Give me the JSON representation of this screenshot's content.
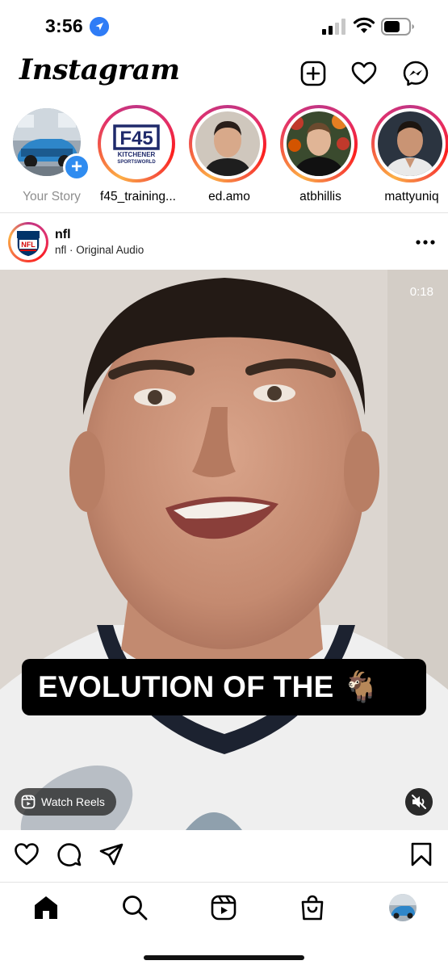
{
  "status_bar": {
    "time": "3:56",
    "icons": [
      "location-arrow-icon",
      "cellular-signal-icon",
      "wifi-icon",
      "battery-icon"
    ]
  },
  "header": {
    "logo_text": "Instagram",
    "icons": [
      "new-post-icon",
      "heart-icon",
      "messenger-icon"
    ]
  },
  "stories": [
    {
      "username": "Your Story",
      "own": true
    },
    {
      "username": "f45_training...",
      "own": false
    },
    {
      "username": "ed.amo",
      "own": false
    },
    {
      "username": "atbhillis",
      "own": false
    },
    {
      "username": "mattyuniq",
      "own": false
    }
  ],
  "stories_logo": {
    "brand": "F45",
    "caption_line1": "KITCHENER",
    "caption_line2": "SPORTSWORLD"
  },
  "post": {
    "username": "nfl",
    "subtitle": "nfl · Original Audio",
    "avatar_logo_text": "NFL",
    "duration": "0:18",
    "overlay_text": "EVOLUTION OF THE 🐐",
    "watch_reels_label": "Watch Reels"
  },
  "tab_bar": {
    "items": [
      "home-icon",
      "search-icon",
      "reels-icon",
      "shop-icon",
      "profile-avatar"
    ]
  },
  "colors": {
    "story_ring_start": "#c13584",
    "story_ring_end": "#fcaf45",
    "accent_blue": "#2f8cf0",
    "f45_navy": "#1f2a6b"
  }
}
